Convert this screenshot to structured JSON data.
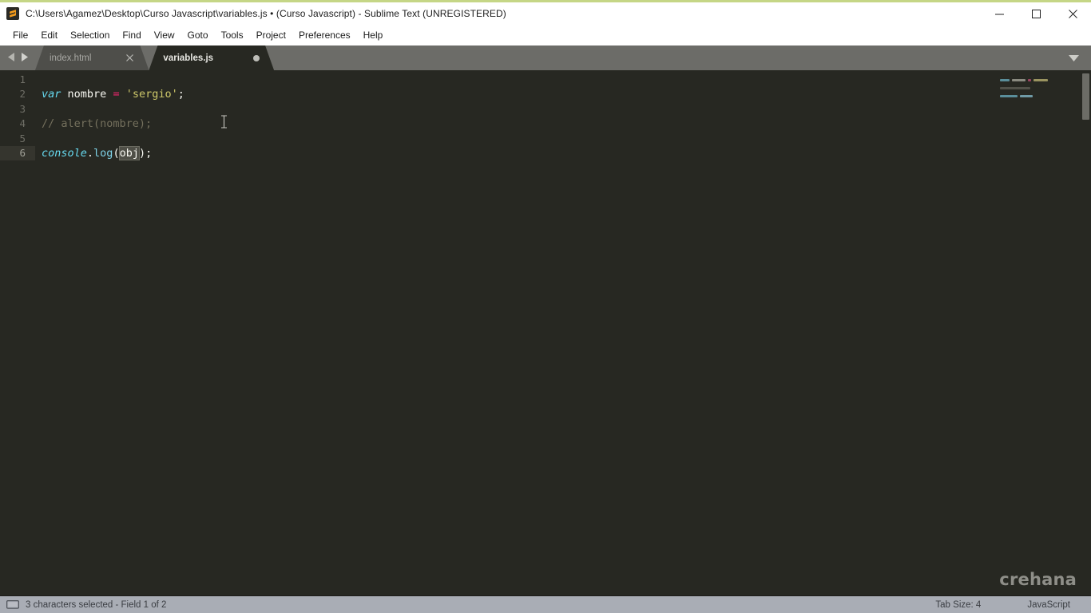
{
  "window": {
    "title": "C:\\Users\\Agamez\\Desktop\\Curso Javascript\\variables.js • (Curso Javascript) - Sublime Text (UNREGISTERED)",
    "app_icon": "sublime-text-icon",
    "controls": {
      "minimize": "minimize-icon",
      "maximize": "maximize-icon",
      "close": "close-icon"
    },
    "accent_color": "#c5d686"
  },
  "menubar": {
    "items": [
      {
        "label": "File"
      },
      {
        "label": "Edit"
      },
      {
        "label": "Selection"
      },
      {
        "label": "Find"
      },
      {
        "label": "View"
      },
      {
        "label": "Goto"
      },
      {
        "label": "Tools"
      },
      {
        "label": "Project"
      },
      {
        "label": "Preferences"
      },
      {
        "label": "Help"
      }
    ]
  },
  "tabbar": {
    "nav_prev_icon": "chevron-left-icon",
    "nav_next_icon": "chevron-right-icon",
    "menu_icon": "chevron-down-icon",
    "tabs": [
      {
        "label": "index.html",
        "active": false,
        "dirty": false,
        "close_icon": "close-icon"
      },
      {
        "label": "variables.js",
        "active": true,
        "dirty": true,
        "dirty_icon": "unsaved-dot-icon"
      }
    ]
  },
  "editor": {
    "line_numbers": [
      "1",
      "2",
      "3",
      "4",
      "5",
      "6"
    ],
    "current_line": 6,
    "lines": [
      {
        "n": "1",
        "text": ""
      },
      {
        "n": "2",
        "text": "var nombre = 'sergio';"
      },
      {
        "n": "3",
        "text": ""
      },
      {
        "n": "4",
        "text": "// alert(nombre);"
      },
      {
        "n": "5",
        "text": ""
      },
      {
        "n": "6",
        "text": "console.log(obj);"
      }
    ],
    "tokens": {
      "l2_kw": "var",
      "l2_space1": " ",
      "l2_name": "nombre",
      "l2_space2": " ",
      "l2_eq": "=",
      "l2_space3": " ",
      "l2_str": "'sergio'",
      "l2_semi": ";",
      "l4_comment": "// alert(nombre);",
      "l6_obj": "console",
      "l6_dot": ".",
      "l6_fn": "log",
      "l6_open": "(",
      "l6_sel": "obj",
      "l6_close": ");"
    },
    "selection": "obj",
    "colors": {
      "background": "#272822",
      "keyword": "#66d9ef",
      "operator": "#f92672",
      "string": "#cfc96a",
      "comment": "#74705d",
      "function": "#7fd3e8",
      "foreground": "#f8f8f2"
    },
    "watermark": "crehana"
  },
  "statusbar": {
    "icon": "monitor-icon",
    "message": "3 characters selected - Field 1 of 2",
    "tab_size": "Tab Size: 4",
    "syntax": "JavaScript"
  }
}
